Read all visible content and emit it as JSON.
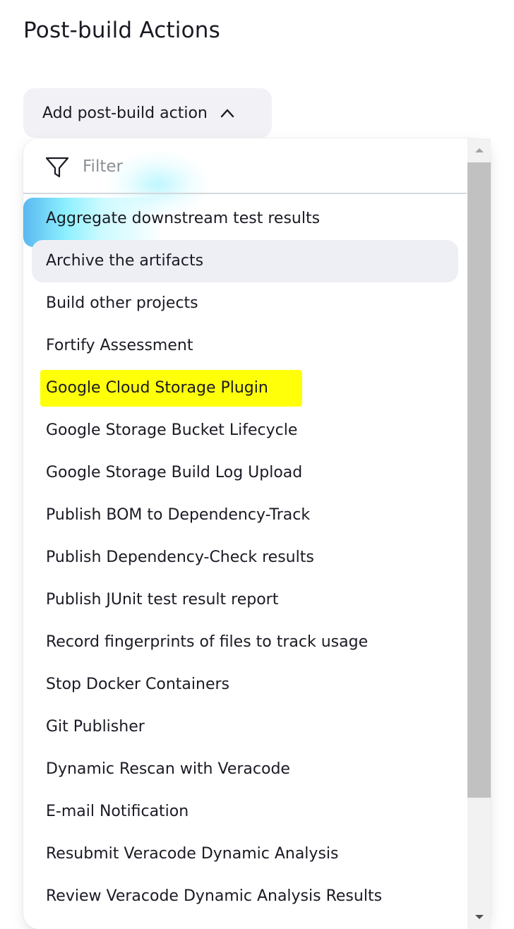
{
  "section": {
    "title": "Post-build Actions"
  },
  "add_button": {
    "label": "Add post-build action",
    "icon": "chevron-up-icon",
    "expanded": true
  },
  "dropdown": {
    "filter": {
      "placeholder": "Filter",
      "value": "",
      "icon": "filter-funnel-icon"
    },
    "items": [
      {
        "label": "Aggregate downstream test results",
        "state": "active"
      },
      {
        "label": "Archive the artifacts",
        "state": "hovered"
      },
      {
        "label": "Build other projects",
        "state": ""
      },
      {
        "label": "Fortify Assessment",
        "state": ""
      },
      {
        "label": "Google Cloud Storage Plugin",
        "state": "highlighted"
      },
      {
        "label": "Google Storage Bucket Lifecycle",
        "state": ""
      },
      {
        "label": "Google Storage Build Log Upload",
        "state": ""
      },
      {
        "label": "Publish BOM to Dependency-Track",
        "state": ""
      },
      {
        "label": "Publish Dependency-Check results",
        "state": ""
      },
      {
        "label": "Publish JUnit test result report",
        "state": ""
      },
      {
        "label": "Record fingerprints of files to track usage",
        "state": ""
      },
      {
        "label": "Stop Docker Containers",
        "state": ""
      },
      {
        "label": "Git Publisher",
        "state": ""
      },
      {
        "label": "Dynamic Rescan with Veracode",
        "state": ""
      },
      {
        "label": "E-mail Notification",
        "state": ""
      },
      {
        "label": "Resubmit Veracode Dynamic Analysis",
        "state": ""
      },
      {
        "label": "Review Veracode Dynamic Analysis Results",
        "state": ""
      }
    ]
  },
  "colors": {
    "highlight": "#ffff0a",
    "hover_bg": "#eeeff5",
    "button_bg": "#f1f1f6",
    "active_gradient_start": "#5ab8f0",
    "active_gradient_mid": "#8cf0ff",
    "scroll_thumb": "#c1c1c1",
    "scroll_track": "#f2f2f2"
  }
}
